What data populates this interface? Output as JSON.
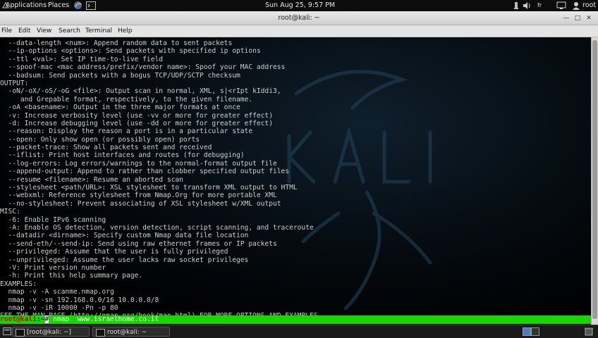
{
  "topbar": {
    "applications": "Applications",
    "places": "Places",
    "clock": "Sun Aug 25,  9:57 PM",
    "language": "fr",
    "user": "root"
  },
  "window": {
    "title": "root@kali: ~"
  },
  "menu": [
    "File",
    "Edit",
    "View",
    "Search",
    "Terminal",
    "Help"
  ],
  "terminal": {
    "lines": [
      "  --data-length <num>: Append random data to sent packets",
      "  --ip-options <options>: Send packets with specified ip options",
      "  --ttl <val>: Set IP time-to-live field",
      "  --spoof-mac <mac address/prefix/vendor name>: Spoof your MAC address",
      "  --badsum: Send packets with a bogus TCP/UDP/SCTP checksum",
      "OUTPUT:",
      "  -oN/-oX/-oS/-oG <file>: Output scan in normal, XML, s|<rIpt kIddi3,",
      "     and Grepable format, respectively, to the given filename.",
      "  -oA <basename>: Output in the three major formats at once",
      "  -v: Increase verbosity level (use -vv or more for greater effect)",
      "  -d: Increase debugging level (use -dd or more for greater effect)",
      "  --reason: Display the reason a port is in a particular state",
      "  --open: Only show open (or possibly open) ports",
      "  --packet-trace: Show all packets sent and received",
      "  --iflist: Print host interfaces and routes (for debugging)",
      "  --log-errors: Log errors/warnings to the normal-format output file",
      "  --append-output: Append to rather than clobber specified output files",
      "  --resume <filename>: Resume an aborted scan",
      "  --stylesheet <path/URL>: XSL stylesheet to transform XML output to HTML",
      "  --webxml: Reference stylesheet from Nmap.Org for more portable XML",
      "  --no-stylesheet: Prevent associating of XSL stylesheet w/XML output",
      "MISC:",
      "  -6: Enable IPv6 scanning",
      "  -A: Enable OS detection, version detection, script scanning, and traceroute",
      "  --datadir <dirname>: Specify custom Nmap data file location",
      "  --send-eth/--send-ip: Send using raw ethernet frames or IP packets",
      "  --privileged: Assume that the user is fully privileged",
      "  --unprivileged: Assume the user lacks raw socket privileges",
      "  -V: Print version number",
      "  -h: Print this help summary page.",
      "EXAMPLES:",
      "  nmap -v -A scanme.nmap.org",
      "  nmap -v -sn 192.168.0.0/16 10.0.0.0/8",
      "  nmap -v -iR 10000 -Pn -p 80",
      "SEE THE MAN PAGE (http://nmap.org/book/man.html) FOR MORE OPTIONS AND EXAMPLES"
    ],
    "prompt_user": "root@kali",
    "prompt_path": ":~",
    "prompt_symbol": "#",
    "command": " nmap  www.israelhome.co.il"
  },
  "taskbar": {
    "tasks": [
      "[root@kali: ~]",
      "root@kali: ~"
    ]
  },
  "colors": {
    "prompt_bg": "#19d600",
    "prompt_user": "#cc0000",
    "prompt_path": "#0000c8",
    "terminal_text": "#cfcfcf"
  }
}
